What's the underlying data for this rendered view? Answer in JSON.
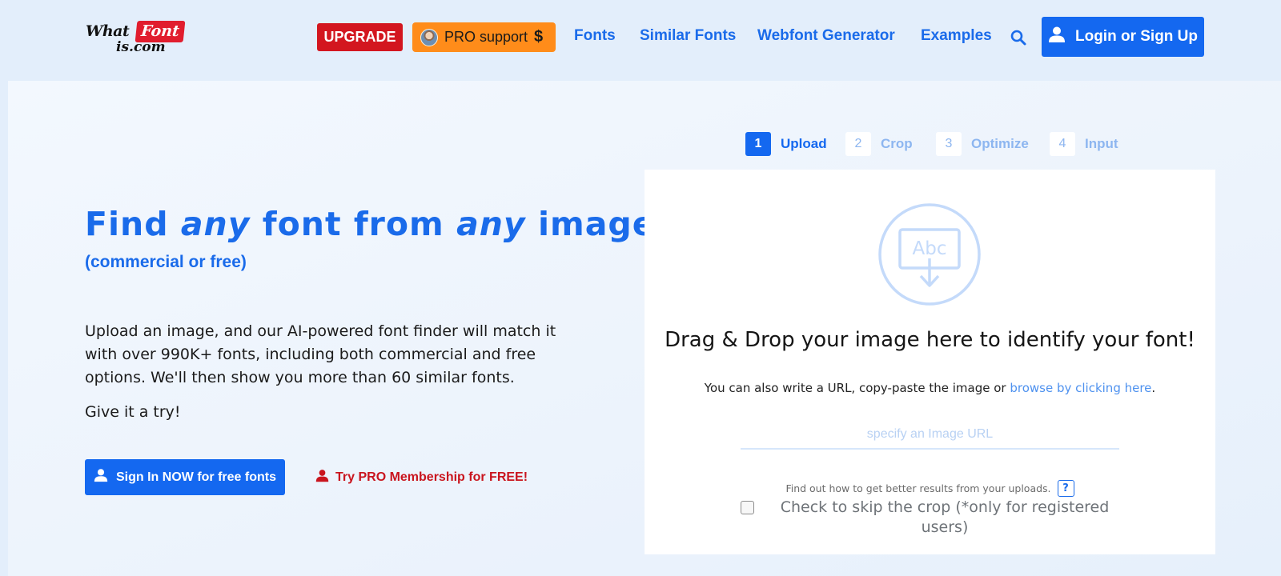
{
  "header": {
    "logo": {
      "what": "What",
      "font": "Font",
      "iscom": "is.com"
    },
    "upgrade_label": "UPGRADE",
    "pro_support_label": "PRO support",
    "pro_support_symbol": "$",
    "nav": [
      {
        "label": "Fonts"
      },
      {
        "label": "Similar Fonts"
      },
      {
        "label": "Webfont Generator"
      },
      {
        "label": "Examples"
      }
    ],
    "login_label": "Login or Sign Up"
  },
  "hero": {
    "title_find": "Find",
    "title_any1": "any",
    "title_font_from": "font from",
    "title_any2": "any",
    "title_image": "image",
    "subtitle": "(commercial or free)",
    "description": "Upload an image, and our AI-powered font finder will match it with over 990K+ fonts, including both commercial and free options. We'll then show you more than 60 similar fonts.",
    "try_text": "Give it a try!",
    "signin_label": "Sign In NOW for free fonts",
    "trypro_label": "Try PRO Membership for FREE!"
  },
  "steps": [
    {
      "num": "1",
      "label": "Upload"
    },
    {
      "num": "2",
      "label": "Crop"
    },
    {
      "num": "3",
      "label": "Optimize"
    },
    {
      "num": "4",
      "label": "Input"
    }
  ],
  "upload": {
    "icon_text": "Abc",
    "title": "Drag & Drop your image here to identify your font!",
    "sub_prefix": "You can also write a URL, copy-paste the image or ",
    "sub_link": "browse by clicking here",
    "sub_suffix": ".",
    "url_placeholder": "specify an Image URL",
    "tips_text": "Find out how to get better results from your uploads.",
    "help_label": "?",
    "skip_crop_label": "Check to skip the crop (*only for registered users)"
  },
  "colors": {
    "accent_blue": "#1468f0",
    "upgrade_red": "#d3161f",
    "pro_orange": "#ff8c1a",
    "pro_link_red": "#c9151e"
  },
  "icons": {
    "search": "search-icon",
    "user": "user-icon",
    "upload": "upload-image-icon"
  }
}
